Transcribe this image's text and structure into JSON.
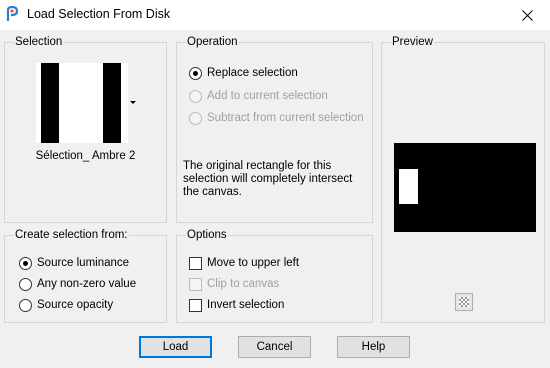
{
  "window": {
    "title": "Load Selection From Disk"
  },
  "selection": {
    "heading": "Selection",
    "file_name": "Sélection_ Ambre 2"
  },
  "operation": {
    "heading": "Operation",
    "options": [
      {
        "label": "Replace selection",
        "checked": true,
        "enabled": true
      },
      {
        "label": "Add to current selection",
        "checked": false,
        "enabled": false
      },
      {
        "label": "Subtract from current selection",
        "checked": false,
        "enabled": false
      }
    ],
    "description": "The original rectangle for this selection will completely intersect the canvas."
  },
  "preview": {
    "heading": "Preview"
  },
  "create_from": {
    "heading": "Create selection from:",
    "options": [
      {
        "label": "Source luminance",
        "checked": true
      },
      {
        "label": "Any non-zero value",
        "checked": false
      },
      {
        "label": "Source opacity",
        "checked": false
      }
    ]
  },
  "options": {
    "heading": "Options",
    "items": [
      {
        "label": "Move to upper left",
        "checked": false,
        "enabled": true
      },
      {
        "label": "Clip to canvas",
        "checked": false,
        "enabled": false
      },
      {
        "label": "Invert selection",
        "checked": false,
        "enabled": true
      }
    ]
  },
  "buttons": {
    "load": "Load",
    "cancel": "Cancel",
    "help": "Help"
  },
  "colors": {
    "accent": "#0078d7",
    "panel_border": "#d5d5d5",
    "background": "#f0f0f0"
  }
}
